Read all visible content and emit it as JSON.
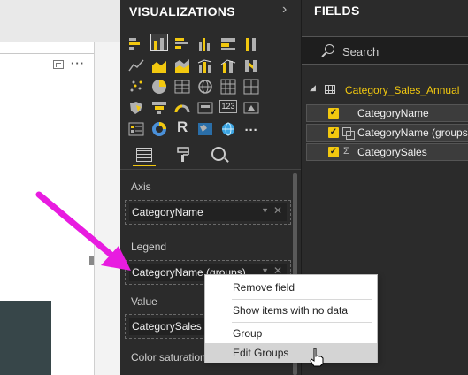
{
  "canvas": {
    "more_options": "···"
  },
  "visualizations": {
    "title": "VISUALIZATIONS",
    "collapse_icon": "chevron-right-icon",
    "letter_icons": [
      "R"
    ],
    "badge_text": "123",
    "more_visuals": "···",
    "tabs": [
      "fields-tab",
      "format-tab",
      "analytics-tab"
    ],
    "wells": {
      "axis": {
        "label": "Axis",
        "value": "CategoryName"
      },
      "legend": {
        "label": "Legend",
        "value": "CategoryName (groups)"
      },
      "value": {
        "label": "Value",
        "value": "CategorySales"
      },
      "color_saturation": {
        "label": "Color saturation"
      }
    },
    "pill_chevron": "▼",
    "pill_close": "✕"
  },
  "fields": {
    "title": "FIELDS",
    "search_placeholder": "Search",
    "table": {
      "expand": "◢",
      "name": "Category_Sales_Annual"
    },
    "items": [
      {
        "label": "CategoryName",
        "check": "✓",
        "icon": ""
      },
      {
        "label": "CategoryName (groups)",
        "check": "✓",
        "icon": "group-icon"
      },
      {
        "label": "CategorySales",
        "check": "✓",
        "icon": "Σ"
      }
    ]
  },
  "context_menu": {
    "items": [
      "Remove field",
      "Show items with no data",
      "Group",
      "Edit Groups"
    ],
    "hovered": "Edit Groups"
  },
  "colors": {
    "accent": "#f2c80f",
    "pane_bg": "#2b2b2b",
    "arrow": "#e81ce0",
    "chart_bar": "#374649"
  }
}
